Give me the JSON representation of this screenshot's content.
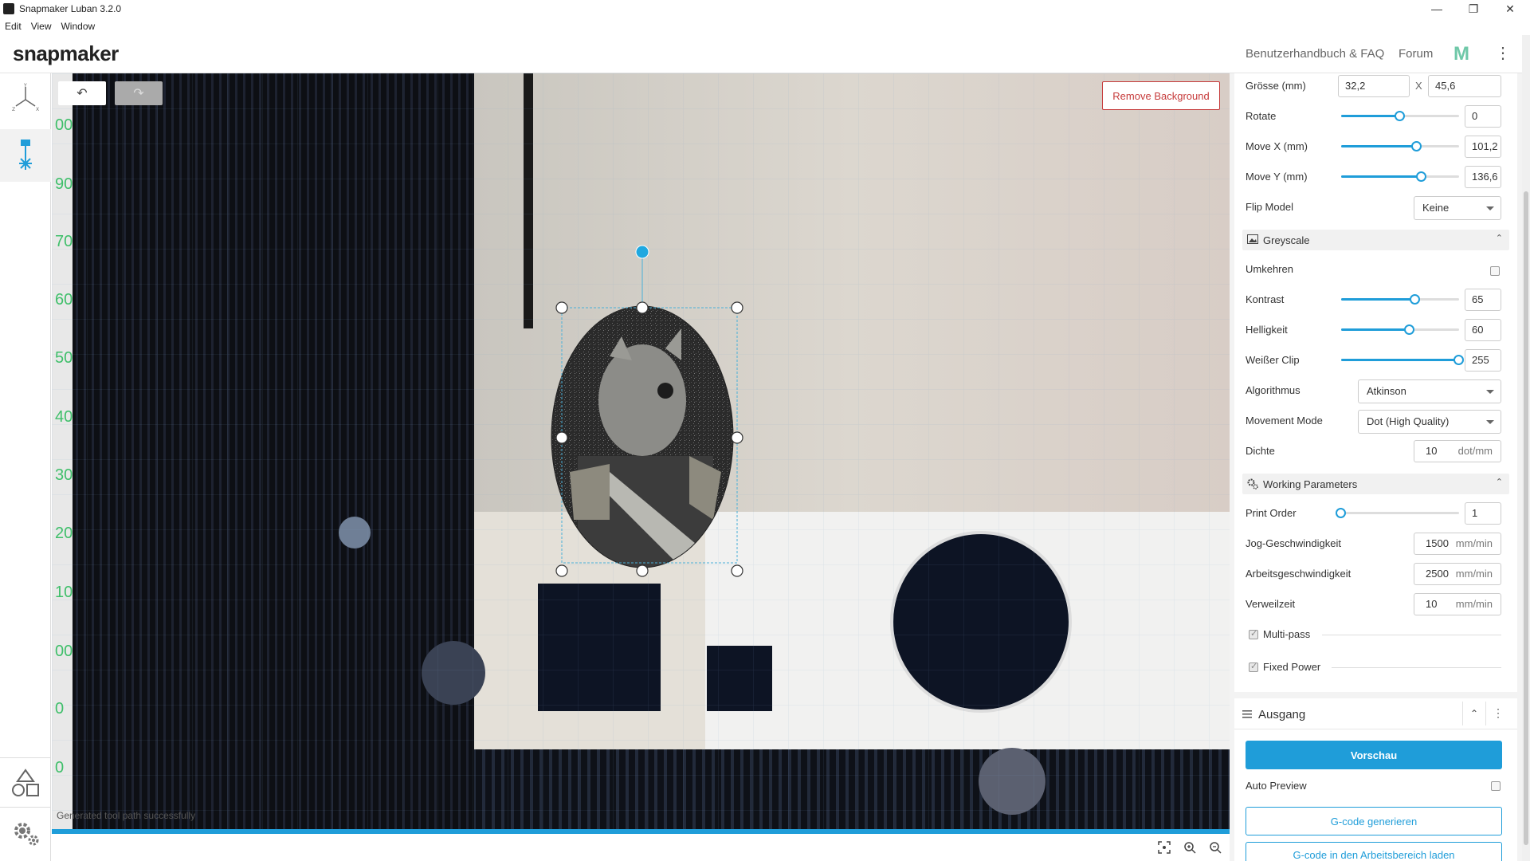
{
  "window": {
    "title": "Snapmaker Luban 3.2.0",
    "minimize": "—",
    "maximize": "❐",
    "close": "✕"
  },
  "menu": [
    "Edit",
    "View",
    "Window"
  ],
  "header": {
    "logo": "snapmaker",
    "links": [
      "Benutzerhandbuch & FAQ",
      "Forum"
    ],
    "brand_icon": "M",
    "more": "⋮"
  },
  "icons": {
    "axes": "axes-icon",
    "laser": "laser-icon",
    "shapes": "shapes-icon",
    "settings": "gear-icon",
    "undo": "↶",
    "redo": "↷"
  },
  "canvas": {
    "remove_background": "Remove Background",
    "status": "Generated tool path successfully",
    "ruler": [
      "00",
      "90",
      "70",
      "60",
      "50",
      "40",
      "30",
      "20",
      "10",
      "00",
      "0",
      "0"
    ]
  },
  "colors": {
    "accent": "#1f9dd9",
    "danger": "#c63a3a",
    "ruler": "#3fbf6a"
  },
  "transform": {
    "size_label": "Grösse (mm)",
    "size_w": "32,2",
    "size_sep": "X",
    "size_h": "45,6",
    "rotate_label": "Rotate",
    "rotate_value": "0",
    "rotate_pos": 0.5,
    "movex_label": "Move X (mm)",
    "movex_value": "101,2",
    "movex_pos": 0.64,
    "movey_label": "Move Y (mm)",
    "movey_value": "136,6",
    "movey_pos": 0.68,
    "flip_label": "Flip Model",
    "flip_value": "Keine"
  },
  "greyscale": {
    "title": "Greyscale",
    "invert_label": "Umkehren",
    "contrast_label": "Kontrast",
    "contrast_value": "65",
    "contrast_pos": 0.63,
    "brightness_label": "Helligkeit",
    "brightness_value": "60",
    "brightness_pos": 0.58,
    "white_clip_label": "Weißer Clip",
    "white_clip_value": "255",
    "white_clip_pos": 1.0,
    "algorithm_label": "Algorithmus",
    "algorithm_value": "Atkinson",
    "movement_label": "Movement Mode",
    "movement_value": "Dot (High Quality)",
    "density_label": "Dichte",
    "density_value": "10",
    "density_unit": "dot/mm"
  },
  "working": {
    "title": "Working Parameters",
    "print_order_label": "Print Order",
    "print_order_value": "1",
    "print_order_pos": 0.0,
    "jog_label": "Jog-Geschwindigkeit",
    "jog_value": "1500",
    "jog_unit": "mm/min",
    "work_label": "Arbeitsgeschwindigkeit",
    "work_value": "2500",
    "work_unit": "mm/min",
    "dwell_label": "Verweilzeit",
    "dwell_value": "10",
    "dwell_unit": "mm/min",
    "multipass_label": "Multi-pass",
    "fixed_power_label": "Fixed Power"
  },
  "output": {
    "title": "Ausgang",
    "preview": "Vorschau",
    "auto_preview": "Auto Preview",
    "generate": "G-code generieren",
    "load": "G-code in den Arbeitsbereich laden"
  }
}
